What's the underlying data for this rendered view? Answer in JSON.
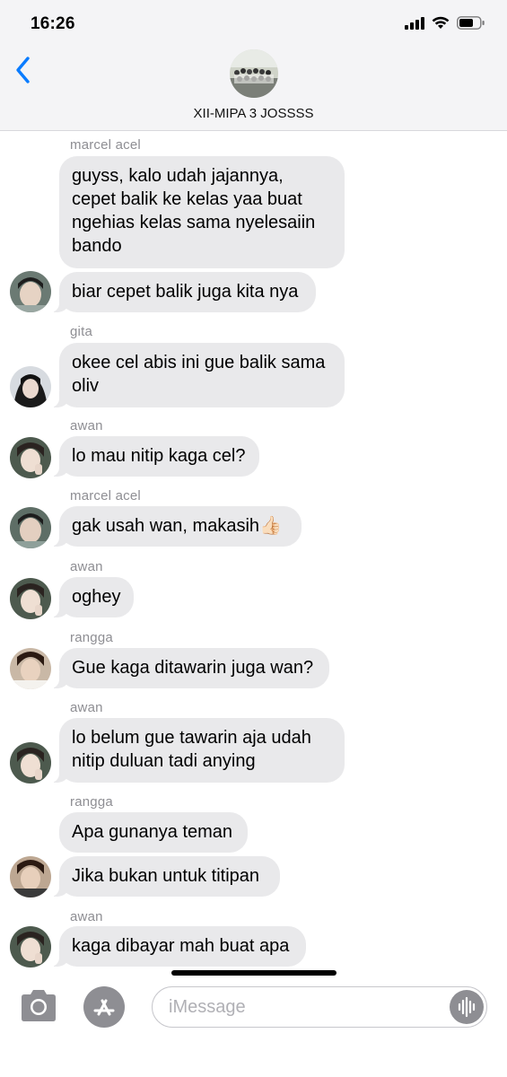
{
  "status_bar": {
    "time": "16:26",
    "signal_icon": "cellular-signal-icon",
    "wifi_icon": "wifi-icon",
    "battery_icon": "battery-icon"
  },
  "header": {
    "back_icon": "chevron-left-icon",
    "group_name": "XII-MIPA 3 JOSSSS",
    "accent_color": "#0a7cff"
  },
  "messages": [
    {
      "sender": "marcel acel",
      "lines": [
        "guyss, kalo udah jajannya,",
        "cepet balik ke kelas yaa buat",
        "ngehias kelas sama nyelesaiin",
        "bando"
      ]
    },
    {
      "sender": "",
      "lines": [
        "biar cepet balik juga kita nya"
      ]
    },
    {
      "sender": "gita",
      "lines": [
        "okee cel abis ini gue balik sama",
        "oliv"
      ]
    },
    {
      "sender": "awan",
      "lines": [
        "lo mau nitip kaga cel?"
      ]
    },
    {
      "sender": "marcel acel",
      "lines": [
        "gak usah wan, makasih👍🏻"
      ]
    },
    {
      "sender": "awan",
      "lines": [
        "oghey"
      ]
    },
    {
      "sender": "rangga",
      "lines": [
        "Gue kaga ditawarin juga wan?"
      ]
    },
    {
      "sender": "awan",
      "lines": [
        "lo belum gue tawarin aja udah",
        "nitip duluan tadi anying"
      ]
    },
    {
      "sender": "rangga",
      "lines": [
        "Apa gunanya teman"
      ]
    },
    {
      "sender": "",
      "lines": [
        "Jika bukan untuk titipan"
      ]
    },
    {
      "sender": "awan",
      "lines": [
        "kaga dibayar mah buat apa"
      ]
    }
  ],
  "composer": {
    "camera_icon": "camera-icon",
    "appstore_icon": "app-store-icon",
    "placeholder": "iMessage",
    "value": "",
    "audio_icon": "audio-waveform-icon"
  },
  "colors": {
    "bubble_gray": "#e9e9eb",
    "sender_gray": "#8e8e93"
  }
}
